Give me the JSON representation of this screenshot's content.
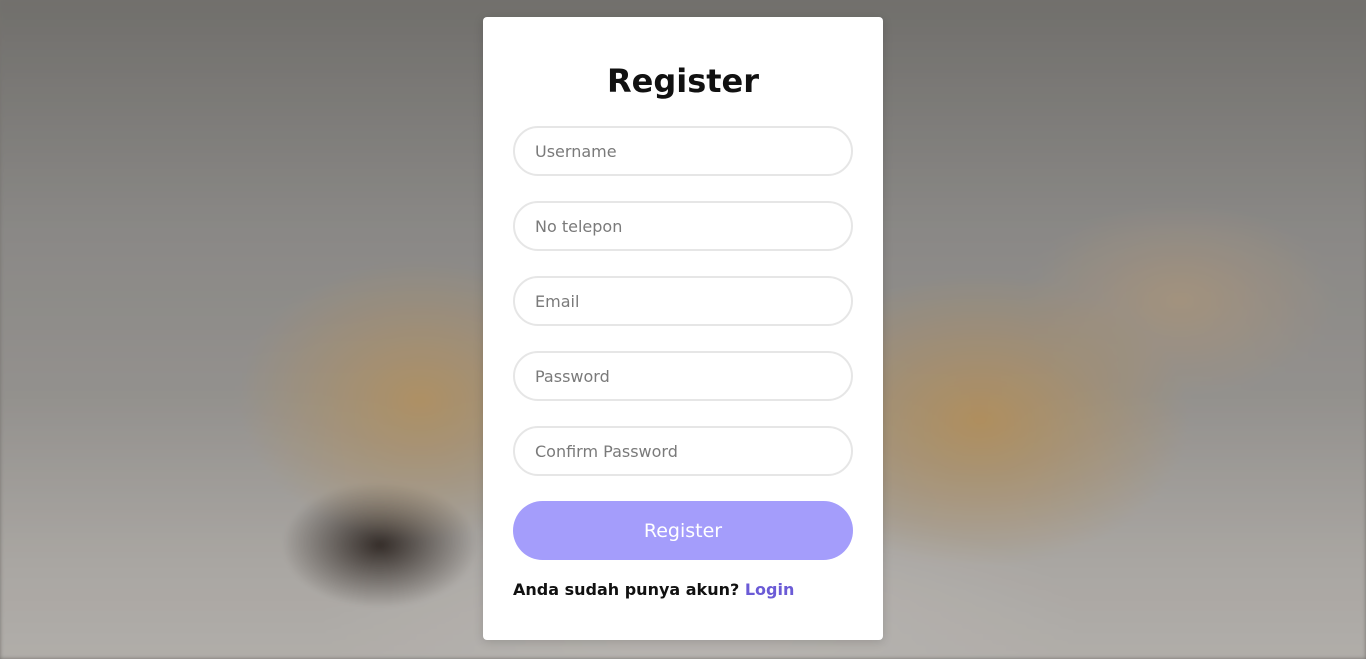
{
  "form": {
    "title": "Register",
    "fields": {
      "username_placeholder": "Username",
      "phone_placeholder": "No telepon",
      "email_placeholder": "Email",
      "password_placeholder": "Password",
      "confirm_password_placeholder": "Confirm Password"
    },
    "submit_label": "Register",
    "footer_text": "Anda sudah punya akun?",
    "login_link_label": "Login"
  },
  "colors": {
    "button": "#a49dfb",
    "link": "#6b5bd6",
    "card": "#ffffff"
  }
}
